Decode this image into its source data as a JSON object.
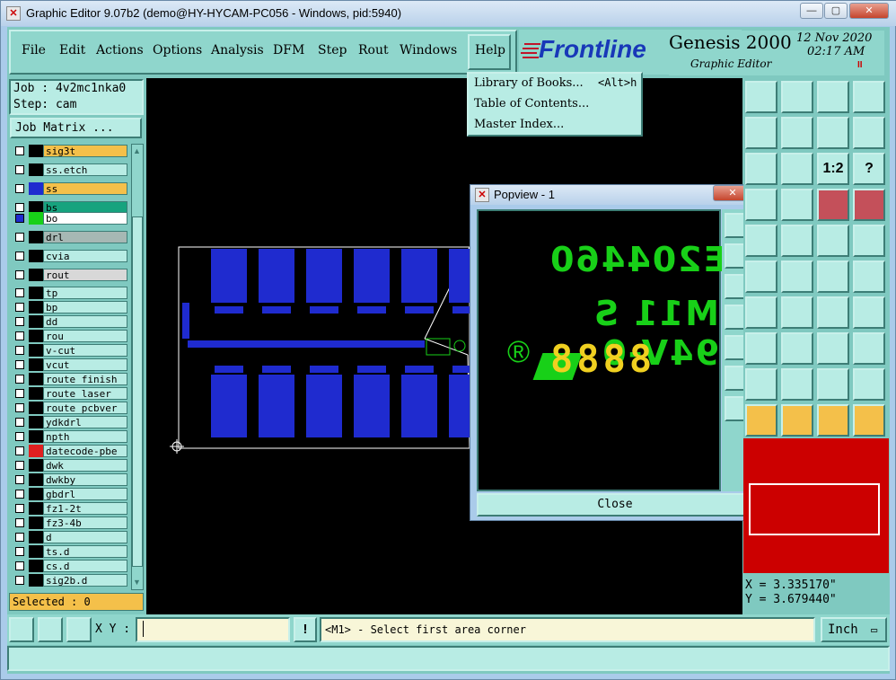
{
  "window": {
    "title": "Graphic Editor 9.07b2 (demo@HY-HYCAM-PC056 - Windows, pid:5940)",
    "min_label": "—",
    "max_label": "▢",
    "close_label": "✕"
  },
  "menu": {
    "items": [
      "File",
      "Edit",
      "Actions",
      "Options",
      "Analysis",
      "DFM",
      "Step",
      "Rout",
      "Windows"
    ],
    "help": "Help"
  },
  "help_menu": {
    "items": [
      {
        "label": "Library of Books...",
        "shortcut": "<Alt>h"
      },
      {
        "label": "Table of Contents...",
        "shortcut": ""
      },
      {
        "label": "Master Index...",
        "shortcut": ""
      }
    ]
  },
  "branding": {
    "logo": "Frontline",
    "product": "Genesis 2000",
    "subtitle": "Graphic Editor",
    "date": "12 Nov 2020",
    "time": "02:17 AM",
    "pause": "II"
  },
  "job": {
    "job_line": "Job : 4v2mc1nka0",
    "step_line": "Step: cam",
    "matrix_button": "Job Matrix ..."
  },
  "layers": [
    {
      "name": "sig3t",
      "color": "#000000",
      "bg": "#f4c04a",
      "checked": false
    },
    {
      "name": "ss.etch",
      "color": "#000000",
      "bg": "#b8ece4",
      "checked": false
    },
    {
      "name": "ss",
      "color": "#1f2bcf",
      "bg": "#f4c04a",
      "checked": false
    },
    {
      "name": "bs",
      "color": "#000000",
      "bg": "#16a37e",
      "checked": false
    },
    {
      "name": "bo",
      "color": "#18d018",
      "bg": "#ffffff",
      "checked": true
    },
    {
      "name": "drl",
      "color": "#000000",
      "bg": "#a6b8b4",
      "checked": false
    },
    {
      "name": "cvia",
      "color": "#000000",
      "bg": "#b8ece4",
      "checked": false
    },
    {
      "name": "rout",
      "color": "#000000",
      "bg": "#d8d8d8",
      "checked": false
    },
    {
      "name": "tp",
      "color": "#000000",
      "bg": "#b8ece4",
      "checked": false
    },
    {
      "name": "bp",
      "color": "#000000",
      "bg": "#b8ece4",
      "checked": false
    },
    {
      "name": "dd",
      "color": "#000000",
      "bg": "#b8ece4",
      "checked": false
    },
    {
      "name": "rou",
      "color": "#000000",
      "bg": "#b8ece4",
      "checked": false
    },
    {
      "name": "v-cut",
      "color": "#000000",
      "bg": "#b8ece4",
      "checked": false
    },
    {
      "name": "vcut",
      "color": "#000000",
      "bg": "#b8ece4",
      "checked": false
    },
    {
      "name": "route_finish",
      "color": "#000000",
      "bg": "#b8ece4",
      "checked": false
    },
    {
      "name": "route_laser",
      "color": "#000000",
      "bg": "#b8ece4",
      "checked": false
    },
    {
      "name": "route_pcbver",
      "color": "#000000",
      "bg": "#b8ece4",
      "checked": false
    },
    {
      "name": "ydkdrl",
      "color": "#000000",
      "bg": "#b8ece4",
      "checked": false
    },
    {
      "name": "npth",
      "color": "#000000",
      "bg": "#b8ece4",
      "checked": false
    },
    {
      "name": "datecode-pbe",
      "color": "#e02020",
      "bg": "#b8ece4",
      "checked": false
    },
    {
      "name": "dwk",
      "color": "#000000",
      "bg": "#b8ece4",
      "checked": false
    },
    {
      "name": "dwkby",
      "color": "#000000",
      "bg": "#b8ece4",
      "checked": false
    },
    {
      "name": "gbdrl",
      "color": "#000000",
      "bg": "#b8ece4",
      "checked": false
    },
    {
      "name": "fz1-2t",
      "color": "#000000",
      "bg": "#b8ece4",
      "checked": false
    },
    {
      "name": "fz3-4b",
      "color": "#000000",
      "bg": "#b8ece4",
      "checked": false
    },
    {
      "name": "d",
      "color": "#000000",
      "bg": "#b8ece4",
      "checked": false
    },
    {
      "name": "ts.d",
      "color": "#000000",
      "bg": "#b8ece4",
      "checked": false
    },
    {
      "name": "cs.d",
      "color": "#000000",
      "bg": "#b8ece4",
      "checked": false
    },
    {
      "name": "sig2b.d",
      "color": "#000000",
      "bg": "#b8ece4",
      "checked": false
    }
  ],
  "selected": "Selected : 0",
  "popview": {
    "title": "Popview - 1",
    "line1": "E204460",
    "line2": "M11 S 94V-0",
    "line3": "8888",
    "registered": "®",
    "close_label": "Close"
  },
  "coords": {
    "x": "X =  3.335170\"",
    "y": "Y =  3.679440\""
  },
  "bottom": {
    "xy_label": "X Y :",
    "xy_value": "",
    "warn_label": "!",
    "prompt": "<M1> - Select first area corner",
    "unit": "Inch",
    "status": ""
  },
  "tools": {
    "scale_label": "1:2",
    "help_label": "?",
    "colors": {
      "accent": "#f4c04a",
      "panel": "#8fd6cc",
      "pcb_blue": "#1f2bcf",
      "silk_green": "#18d018"
    }
  }
}
